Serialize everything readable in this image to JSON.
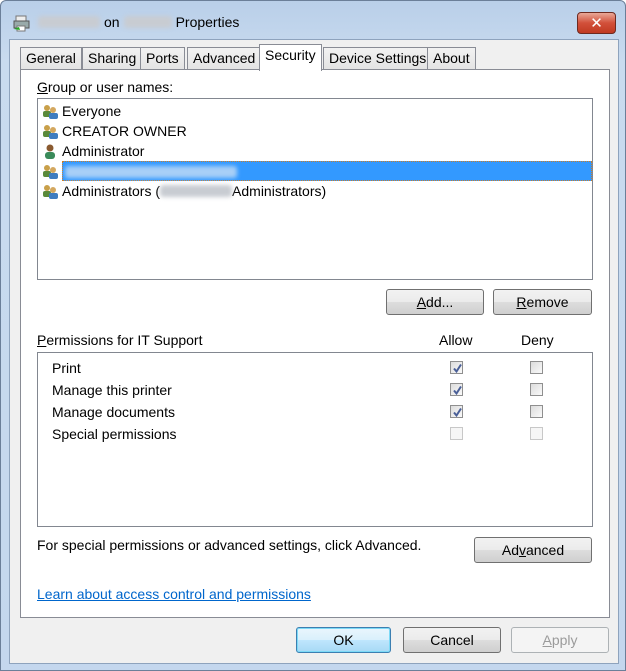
{
  "window": {
    "title_on": "on",
    "title_suffix": "Properties",
    "close_icon": "close-icon"
  },
  "tabs": [
    {
      "label": "General"
    },
    {
      "label": "Sharing"
    },
    {
      "label": "Ports"
    },
    {
      "label": "Advanced"
    },
    {
      "label": "Security",
      "active": true
    },
    {
      "label": "Device Settings"
    },
    {
      "label": "About"
    }
  ],
  "security": {
    "group_label_hotkey": "G",
    "group_label_rest": "roup or user names:",
    "users": [
      {
        "name": "Everyone",
        "icon": "group-icon"
      },
      {
        "name": "CREATOR OWNER",
        "icon": "group-icon"
      },
      {
        "name": "Administrator",
        "icon": "user-icon"
      },
      {
        "name": "",
        "icon": "group-icon",
        "selected": true
      },
      {
        "name_prefix": "Administrators (",
        "name_suffix": "Administrators)",
        "icon": "group-icon"
      }
    ],
    "add_hotkey": "A",
    "add_rest": "dd...",
    "remove_hotkey": "R",
    "remove_rest": "emove",
    "perm_label_hotkey": "P",
    "perm_label_rest": "ermissions for IT Support",
    "allow_header": "Allow",
    "deny_header": "Deny",
    "permissions": [
      {
        "name": "Print",
        "allow": true,
        "deny": false,
        "enabled": true
      },
      {
        "name": "Manage this printer",
        "allow": true,
        "deny": false,
        "enabled": true
      },
      {
        "name": "Manage documents",
        "allow": true,
        "deny": false,
        "enabled": true
      },
      {
        "name": "Special permissions",
        "allow": false,
        "deny": false,
        "enabled": false
      }
    ],
    "special_text": "For special permissions or advanced settings, click Advanced.",
    "advanced_pre": "Ad",
    "advanced_hotkey": "v",
    "advanced_post": "anced",
    "learn_link": "Learn about access control and permissions"
  },
  "footer": {
    "ok": "OK",
    "cancel": "Cancel",
    "apply_hotkey": "A",
    "apply_rest": "pply",
    "apply_enabled": false
  }
}
